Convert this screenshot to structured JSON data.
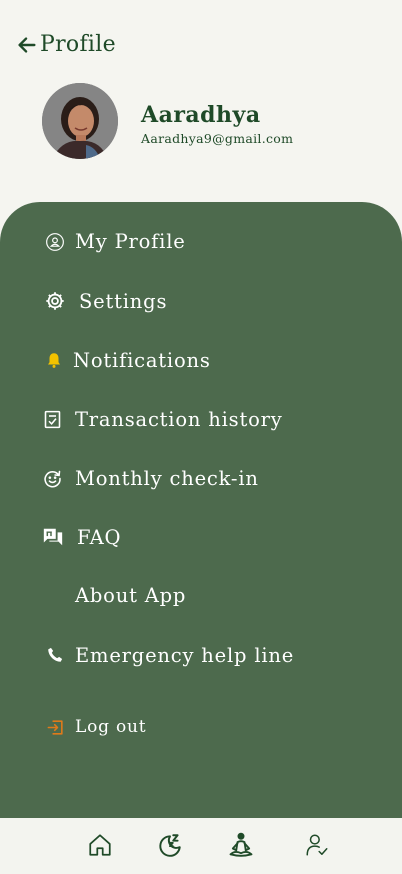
{
  "header": {
    "back_label": "Profile"
  },
  "user": {
    "name": "Aaradhya",
    "email": "Aaradhya9@gmail.com"
  },
  "menu": {
    "items": [
      {
        "label": "My Profile",
        "icon": "user-circle-icon"
      },
      {
        "label": "Settings",
        "icon": "gear-icon"
      },
      {
        "label": "Notifications",
        "icon": "bell-icon"
      },
      {
        "label": "Transaction history",
        "icon": "receipt-check-icon"
      },
      {
        "label": "Monthly check-in",
        "icon": "smile-refresh-icon"
      },
      {
        "label": "FAQ",
        "icon": "chat-bubbles-icon"
      },
      {
        "label": "About App",
        "icon": ""
      },
      {
        "label": "Emergency help line",
        "icon": "phone-icon"
      }
    ],
    "logout_label": "Log out"
  },
  "bottom_nav": {
    "items": [
      "home-icon",
      "moon-sleep-icon",
      "meditation-icon",
      "user-check-icon"
    ],
    "active": "meditation-icon"
  },
  "colors": {
    "menu_bg": "#4d6a4d",
    "primary": "#1f4a28",
    "bell": "#f2c200",
    "logout": "#e07a1a"
  }
}
